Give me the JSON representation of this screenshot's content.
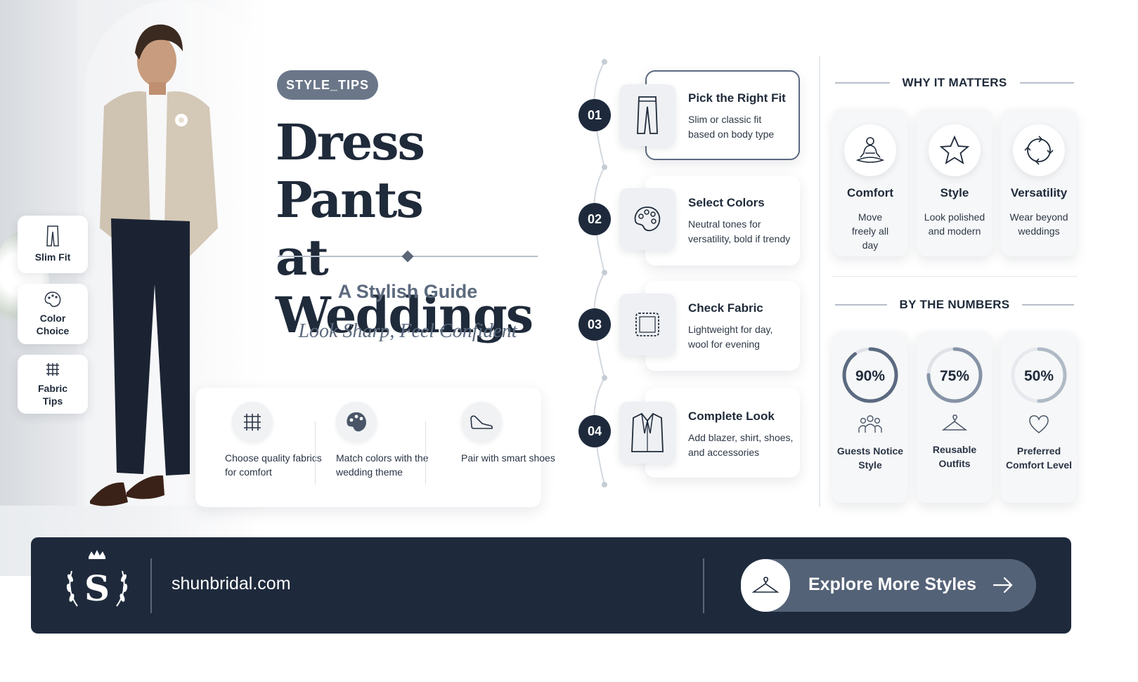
{
  "header": {
    "pill": "STYLE_TIPS",
    "title_line1": "Dress Pants",
    "title_line2": "at Weddings",
    "subtitle": "A Stylish Guide",
    "tagline": "Look Sharp, Feel Confident"
  },
  "side_chips": [
    {
      "label": "Slim Fit",
      "icon": "pants-icon"
    },
    {
      "label": "Color Choice",
      "icon": "palette-icon"
    },
    {
      "label": "Fabric Tips",
      "icon": "fabric-icon"
    }
  ],
  "tips": [
    {
      "text": "Choose quality fabrics for comfort",
      "icon": "fabric-icon"
    },
    {
      "text": "Match colors with the wedding theme",
      "icon": "palette-icon"
    },
    {
      "text": "Pair with smart shoes",
      "icon": "shoe-icon"
    }
  ],
  "steps": [
    {
      "num": "01",
      "title": "Pick the Right Fit",
      "desc": "Slim or classic fit based on body type",
      "icon": "pants-icon"
    },
    {
      "num": "02",
      "title": "Select Colors",
      "desc": "Neutral tones for versatility, bold if trendy",
      "icon": "palette-icon"
    },
    {
      "num": "03",
      "title": "Check Fabric",
      "desc": "Lightweight for day, wool for evening",
      "icon": "fabric-icon"
    },
    {
      "num": "04",
      "title": "Complete Look",
      "desc": "Add blazer, shirt, shoes, and accessories",
      "icon": "blazer-icon"
    }
  ],
  "why": {
    "heading": "WHY IT MATTERS",
    "items": [
      {
        "title": "Comfort",
        "desc": "Move freely all day",
        "icon": "meditation-icon"
      },
      {
        "title": "Style",
        "desc": "Look polished and modern",
        "icon": "star-icon"
      },
      {
        "title": "Versatility",
        "desc": "Wear beyond weddings",
        "icon": "cycle-icon"
      }
    ]
  },
  "numbers": {
    "heading": "BY THE NUMBERS",
    "items": [
      {
        "value": "90%",
        "percent": 90,
        "label": "Guests Notice Style",
        "icon": "people-icon"
      },
      {
        "value": "75%",
        "percent": 75,
        "label": "Reusable Outfits",
        "icon": "hanger-icon"
      },
      {
        "value": "50%",
        "percent": 50,
        "label": "Preferred Comfort Level",
        "icon": "heart-icon"
      }
    ]
  },
  "footer": {
    "logo_letter": "S",
    "domain": "shunbridal.com",
    "cta_label": "Explore More Styles"
  },
  "colors": {
    "navy": "#1e2a3c",
    "slate": "#546277",
    "pill": "#6b7789"
  }
}
